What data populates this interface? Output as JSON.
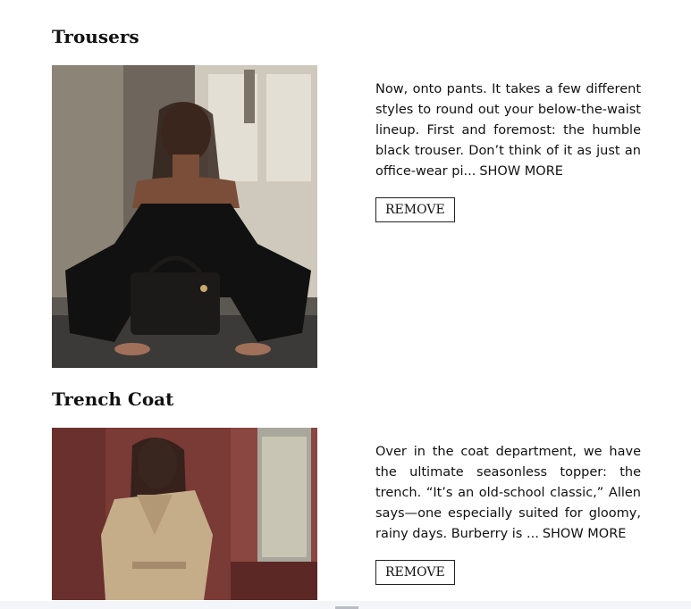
{
  "items": [
    {
      "title": "Trousers",
      "image_alt": "Woman in black strapless jumpsuit crouching with quilted black handbag",
      "description": "Now, onto pants. It takes a few different styles to round out your below-the-waist lineup. First and foremost: the humble black trouser. Don’t think of it as just an office-wear pi...",
      "show_more": "SHOW MORE",
      "remove_label": "REMOVE"
    },
    {
      "title": "Trench Coat",
      "image_alt": "Woman in beige trench coat in front of a maroon door",
      "description": "Over in the coat department, we have the ultimate seasonless topper: the trench. “It’s an old-school classic,” Allen says—one especially suited for gloomy, rainy days. Burberry is ...",
      "show_more": "SHOW MORE",
      "remove_label": "REMOVE"
    }
  ]
}
